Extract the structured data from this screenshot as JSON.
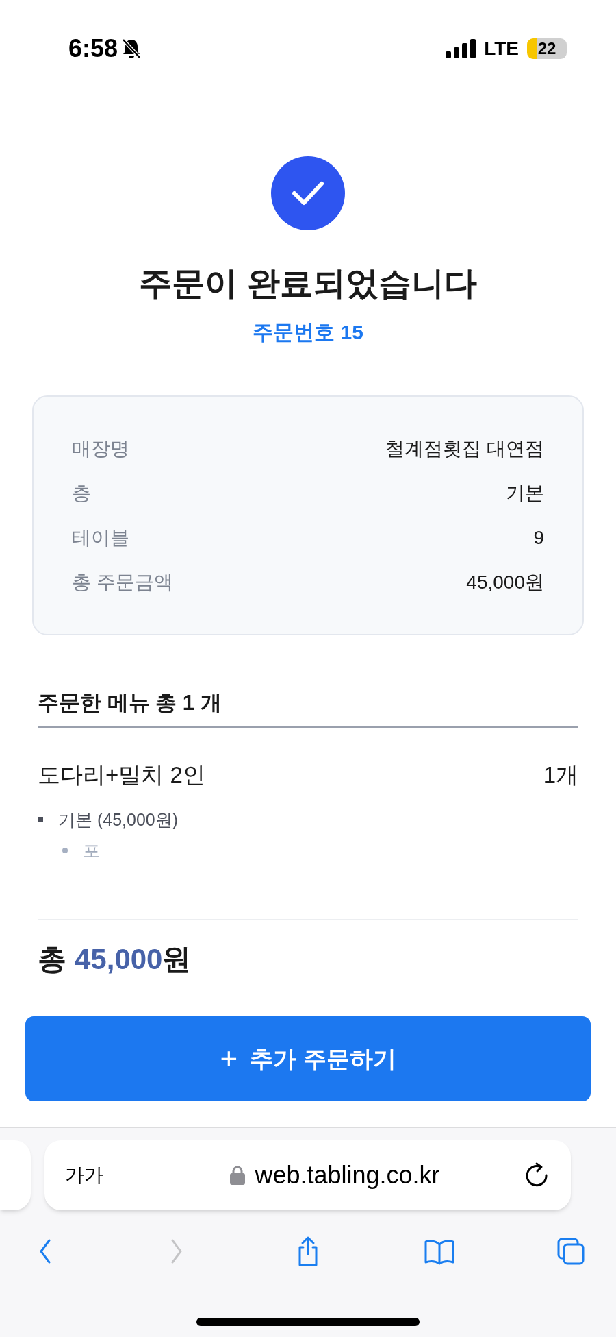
{
  "status_bar": {
    "time": "6:58",
    "network": "LTE",
    "battery": "22"
  },
  "header": {
    "title": "주문이 완료되었습니다",
    "order_number": "주문번호 15"
  },
  "info": [
    {
      "label": "매장명",
      "value": "철계점횟집 대연점"
    },
    {
      "label": "층",
      "value": "기본"
    },
    {
      "label": "테이블",
      "value": "9"
    },
    {
      "label": "총 주문금액",
      "value": "45,000원"
    }
  ],
  "menu_section": {
    "title": "주문한 메뉴 총 1 개",
    "items": [
      {
        "name": "도다리+밀치 2인",
        "quantity": "1개",
        "options": [
          {
            "text": "기본 (45,000원)",
            "children": [
              {
                "text": "포"
              }
            ]
          }
        ]
      }
    ]
  },
  "total": {
    "prefix": "총",
    "amount": "45,000",
    "unit": "원"
  },
  "add_button": {
    "icon": "+",
    "label": "추가 주문하기"
  },
  "browser": {
    "text_size": "가가",
    "url": "web.tabling.co.kr",
    "toolbar": [
      {
        "kind": "back",
        "disabled": false
      },
      {
        "kind": "forward",
        "disabled": true
      },
      {
        "kind": "share",
        "disabled": false
      },
      {
        "kind": "bookmarks",
        "disabled": false
      },
      {
        "kind": "tabs",
        "disabled": false
      }
    ]
  }
}
